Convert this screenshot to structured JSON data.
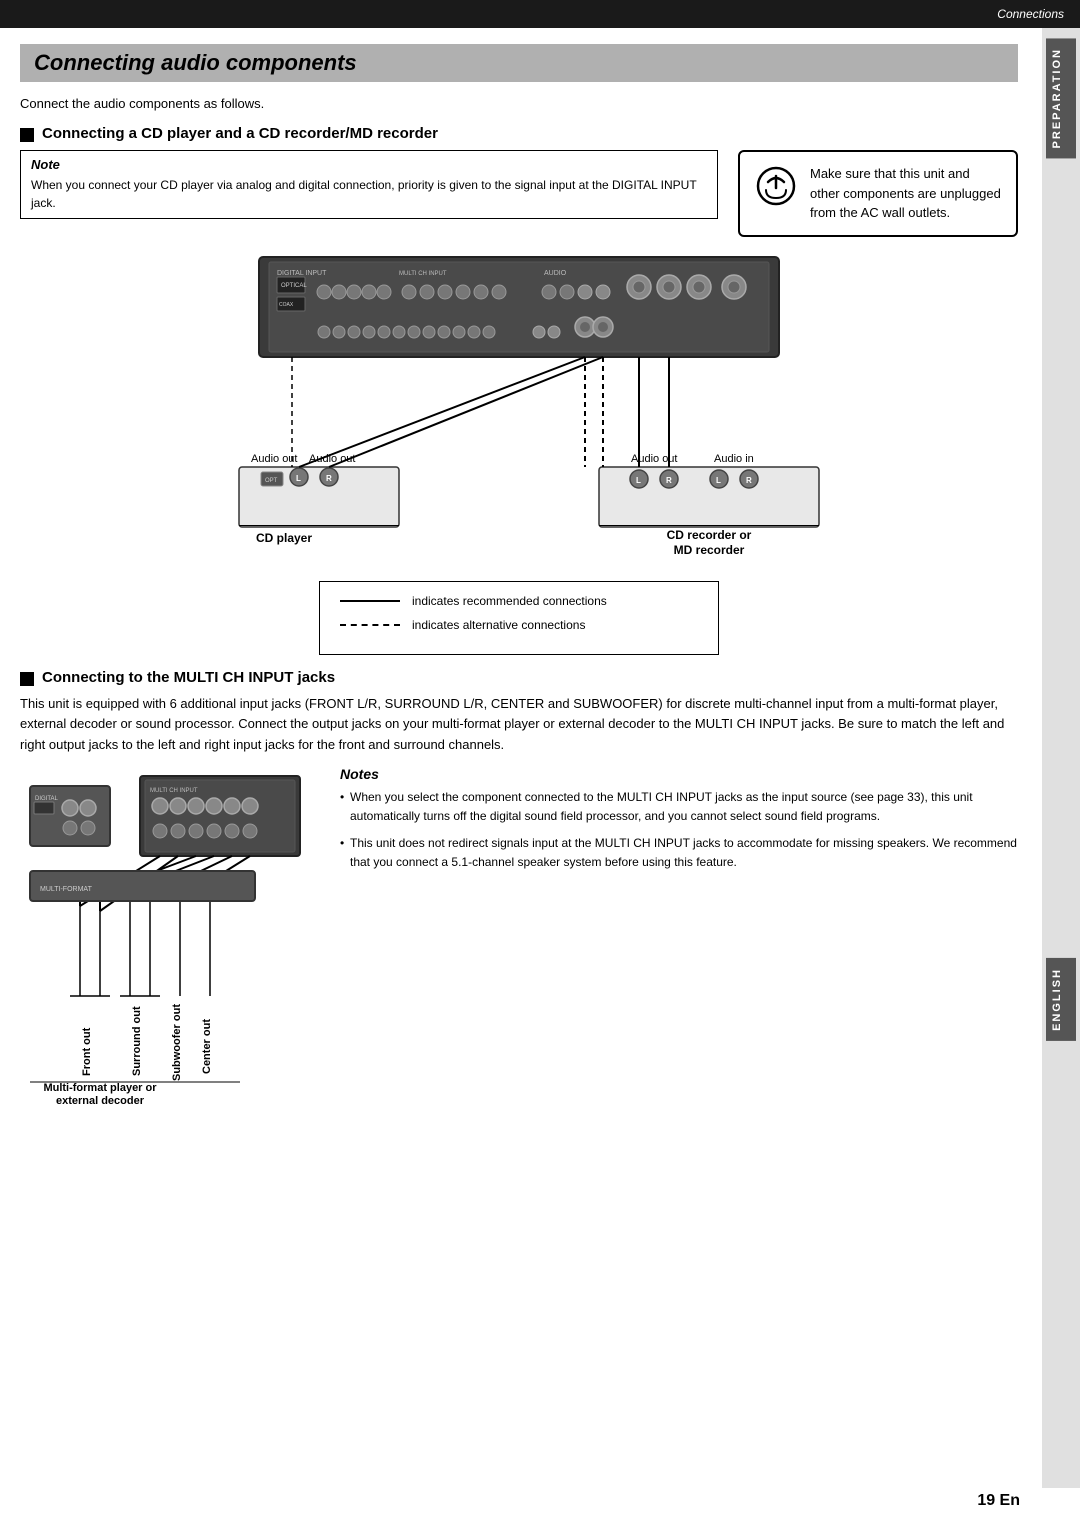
{
  "topBar": {
    "text": "Connections"
  },
  "pageTitle": "Connecting audio components",
  "introText": "Connect the audio components as follows.",
  "section1": {
    "title": "Connecting a CD player and a CD recorder/MD recorder",
    "note": {
      "title": "Note",
      "text": "When you connect your CD player via analog and digital connection, priority is given to the signal input at the DIGITAL INPUT jack."
    },
    "warning": {
      "text": "Make sure that this unit and other components are unplugged from the AC wall outlets."
    }
  },
  "legend": {
    "solidLabel": "indicates recommended connections",
    "dashedLabel": "indicates alternative connections"
  },
  "cdDiagram": {
    "cdPlayer": {
      "label": "CD player",
      "audioOutLeft": "Audio out",
      "audioOutRight": "Audio out"
    },
    "cdRecorder": {
      "label": "CD recorder or\nMD recorder",
      "audioOutLabel": "Audio out",
      "audioInLabel": "Audio in"
    }
  },
  "section2": {
    "title": "Connecting to the MULTI CH INPUT jacks",
    "bodyText": "This unit is equipped with 6 additional input jacks (FRONT L/R, SURROUND L/R, CENTER and SUBWOOFER) for discrete multi-channel input from a multi-format player, external decoder or sound processor. Connect the output jacks on your multi-format player or external decoder to the MULTI CH INPUT jacks. Be sure to match the left and right output jacks to the left and right input jacks for the front and surround channels.",
    "notes": {
      "title": "Notes",
      "items": [
        "When you select the component connected to the MULTI CH INPUT jacks as the input source (see page 33), this unit automatically turns off the digital sound field processor, and you cannot select sound field programs.",
        "This unit does not redirect signals input at the MULTI CH INPUT jacks to accommodate for missing speakers. We recommend that you connect a 5.1-channel speaker system before using this feature."
      ]
    }
  },
  "multiDiagram": {
    "deviceLabel": "Multi-format player or\nexternal decoder",
    "outputs": [
      "Front out",
      "Surround out",
      "Subwoofer out",
      "Center out"
    ]
  },
  "pageNumber": "19 En",
  "sidebarPrep": "PREPARATION",
  "sidebarEng": "English"
}
